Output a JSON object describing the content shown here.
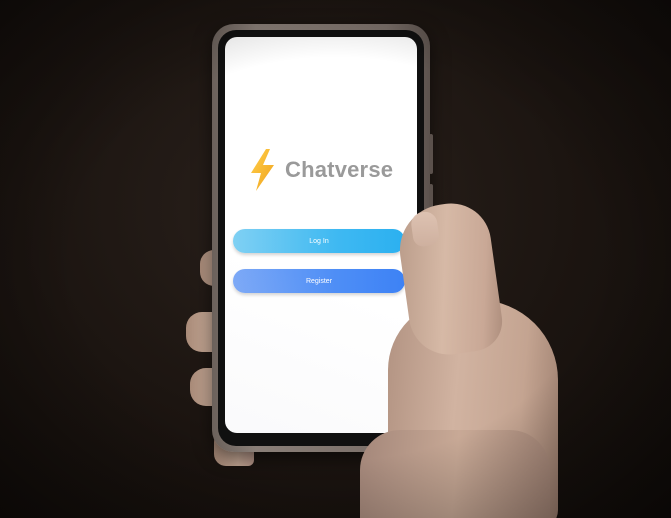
{
  "app": {
    "name": "Chatverse"
  },
  "auth": {
    "login_label": "Log In",
    "register_label": "Register"
  },
  "colors": {
    "logo_bolt": "#f4b328",
    "logo_text": "#9a9a9a",
    "login_button": "#2bb0f0",
    "register_button": "#3d82f5",
    "screen_background": "#ffffff"
  },
  "icons": {
    "logo": "lightning-bolt-icon"
  }
}
